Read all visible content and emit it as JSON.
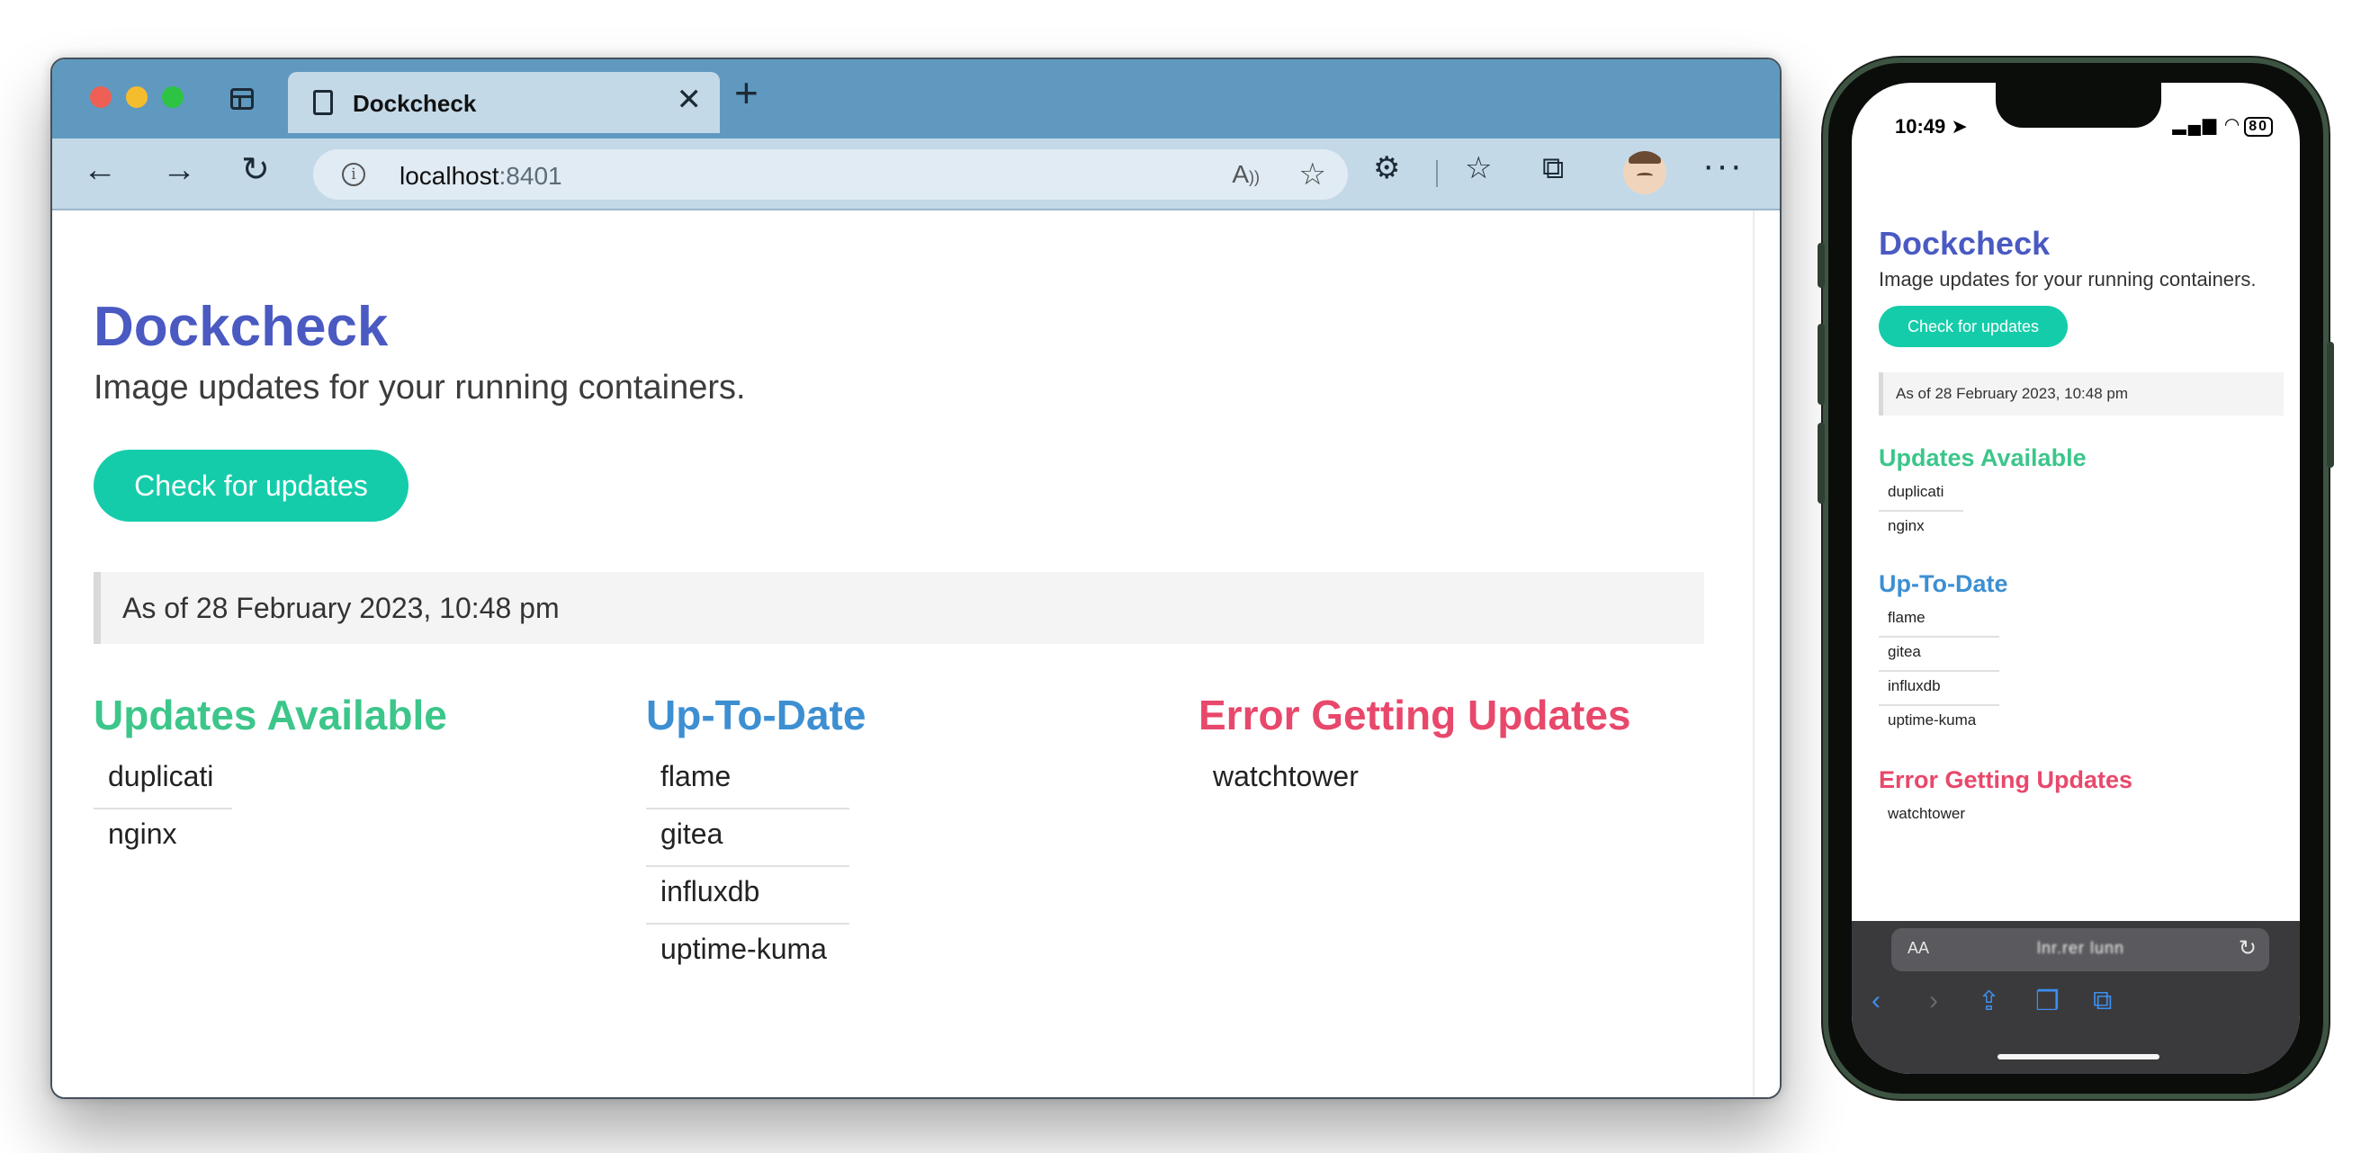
{
  "browser": {
    "tab_title": "Dockcheck",
    "tab_close": "✕",
    "new_tab": "+",
    "url_host": "localhost",
    "url_port": ":8401",
    "nav": {
      "back": "←",
      "forward": "→",
      "reload": "↻"
    },
    "more": "···"
  },
  "app": {
    "title": "Dockcheck",
    "subtitle": "Image updates for your running containers.",
    "check_button": "Check for updates",
    "as_of": "As of 28 February 2023, 10:48 pm",
    "sections": {
      "updates": {
        "heading": "Updates Available",
        "items": [
          "duplicati",
          "nginx"
        ],
        "color": "#3cc68a"
      },
      "uptodate": {
        "heading": "Up-To-Date",
        "items": [
          "flame",
          "gitea",
          "influxdb",
          "uptime-kuma"
        ],
        "color": "#3d8fd2"
      },
      "errors": {
        "heading": "Error Getting Updates",
        "items": [
          "watchtower"
        ],
        "color": "#e8486b"
      }
    },
    "accent_color": "#15ccaa",
    "title_color": "#4a5ac2"
  },
  "phone": {
    "status_time": "10:49",
    "battery": "80",
    "address_aa": "AA",
    "address_text": "lnr.rer lunn"
  }
}
